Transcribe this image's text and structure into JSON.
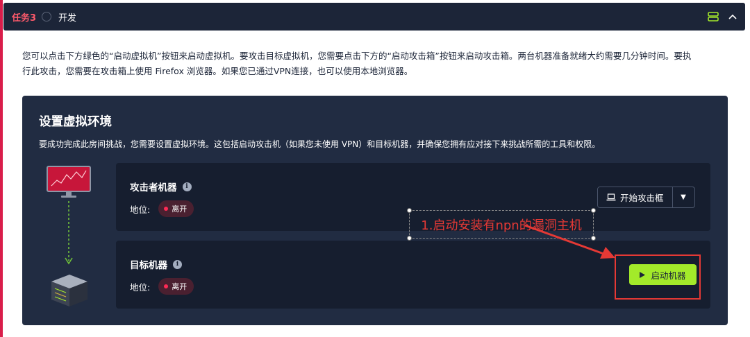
{
  "task": {
    "label": "任务3",
    "title": "开发"
  },
  "description": {
    "line1": "您可以点击下方绿色的“启动虚拟机”按钮来启动虚拟机。要攻击目标虚拟机，您需要点击下方的“启动攻击箱”按钮来启动攻击箱。两台机器准备就绪大约需要几分钟时间。要执",
    "line2": "行此攻击，您需要在攻击箱上使用 Firefox 浏览器。如果您已通过VPN连接，也可以使用本地浏览器。"
  },
  "panel": {
    "title": "设置虚拟环境",
    "subtitle": "要成功完成此房间挑战，您需要设置虚拟环境。这包括启动攻击机（如果您未使用 VPN）和目标机器，并确保您拥有应对接下来挑战所需的工具和权限。"
  },
  "attacker": {
    "title": "攻击者机器",
    "status_label": "地位:",
    "status": "离开",
    "button_label": "开始攻击框"
  },
  "target": {
    "title": "目标机器",
    "status_label": "地位:",
    "status": "离开",
    "button_label": "启动机器"
  },
  "annotation": {
    "text": "1.启动安装有npn的漏洞主机"
  },
  "colors": {
    "accent_red": "#d91d4a",
    "start_green": "#a3ea2a",
    "panel_bg": "#212c42",
    "card_bg": "#161e2f",
    "annotation_red": "#e53935"
  },
  "icons": {
    "header_toggle": "server-icon",
    "header_collapse": "chevron-up-icon",
    "info": "info-icon",
    "attackbox": "laptop-icon",
    "caret": "caret-down-icon",
    "play": "play-icon"
  }
}
